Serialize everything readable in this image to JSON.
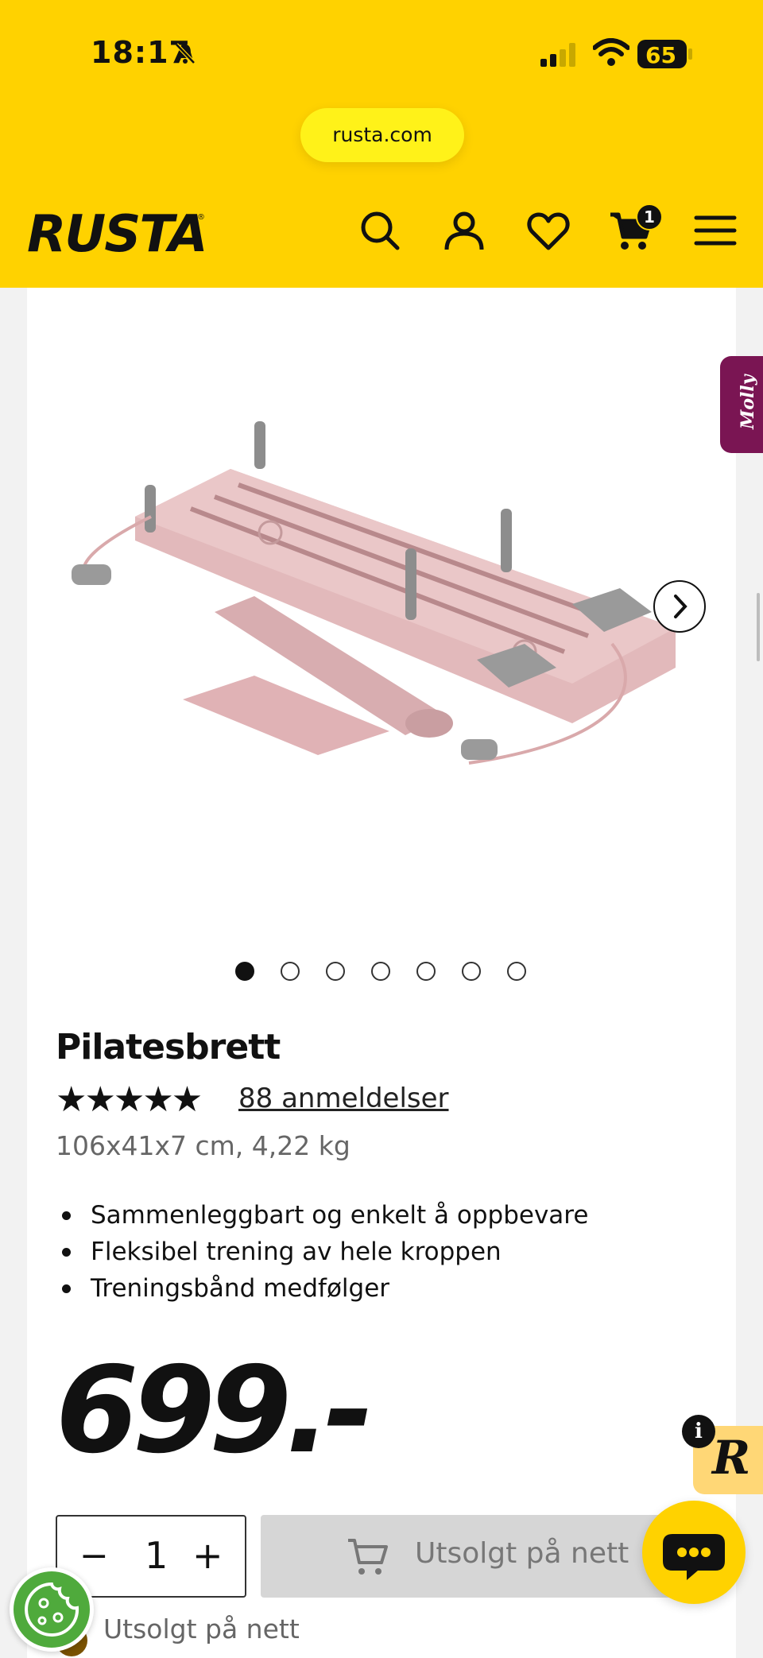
{
  "status_bar": {
    "time": "18:17",
    "battery": "65"
  },
  "browser": {
    "url": "rusta.com"
  },
  "header": {
    "logo": "RUSTA",
    "cart_count": "1"
  },
  "floating": {
    "molly_label": "Molly",
    "info_label": "i",
    "r_label": "R"
  },
  "gallery": {
    "image_count": 7,
    "active_index": 0
  },
  "product": {
    "title": "Pilatesbrett",
    "stars": "★★★★★",
    "rating": 5,
    "reviews_link": "88 anmeldelser",
    "specs": "106x41x7 cm, 4,22 kg",
    "bullets": [
      "Sammenleggbart og enkelt å oppbevare",
      "Fleksibel trening av hele kroppen",
      "Treningsbånd medfølger"
    ],
    "price": "699.-"
  },
  "purchase": {
    "qty_minus": "−",
    "quantity": "1",
    "qty_plus": "+",
    "buy_label": "Utsolgt på nett",
    "stock_status": "Utsolgt på nett"
  },
  "colors": {
    "brand_yellow": "#ffd200",
    "molly_purple": "#7a1553",
    "cookie_green": "#4faa3c"
  }
}
